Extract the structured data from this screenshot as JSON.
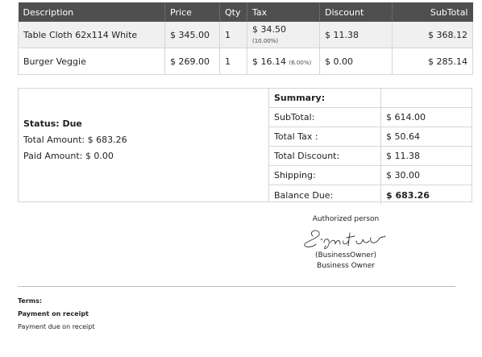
{
  "items_table": {
    "headers": [
      "Description",
      "Price",
      "Qty",
      "Tax",
      "Discount",
      "SubTotal"
    ],
    "rows": [
      {
        "description": "Table Cloth 62x114 White",
        "price": "$ 345.00",
        "qty": "1",
        "tax": "$ 34.50",
        "tax_pct": "(10.00%)",
        "discount": "$ 11.38",
        "subtotal": "$ 368.12"
      },
      {
        "description": "Burger Veggie",
        "price": "$ 269.00",
        "qty": "1",
        "tax": "$ 16.14",
        "tax_pct": "(6.00%)",
        "discount": "$ 0.00",
        "subtotal": "$ 285.14"
      }
    ]
  },
  "status": {
    "title": "Status: Due",
    "total_amount": "Total Amount: $ 683.26",
    "paid_amount": "Paid Amount: $ 0.00"
  },
  "summary": {
    "title": "Summary:",
    "rows": [
      {
        "label": "SubTotal:",
        "value": "$ 614.00"
      },
      {
        "label": "Total Tax :",
        "value": "$ 50.64"
      },
      {
        "label": "Total Discount:",
        "value": "$ 11.38"
      },
      {
        "label": "Shipping:",
        "value": "$ 30.00"
      },
      {
        "label": "Balance Due:",
        "value": "$ 683.26"
      }
    ]
  },
  "signature": {
    "caption": "Authorized person",
    "signature_text": "Signature",
    "name_line": "(BusinessOwner)",
    "role_line": "Business Owner"
  },
  "terms": {
    "heading": "Terms:",
    "title": "Payment on receipt",
    "text": "Payment due on receipt"
  },
  "colors": {
    "header_bg": "#4f4f4f",
    "shaded_row": "#f0f0f0",
    "border": "#d6d6d6"
  }
}
